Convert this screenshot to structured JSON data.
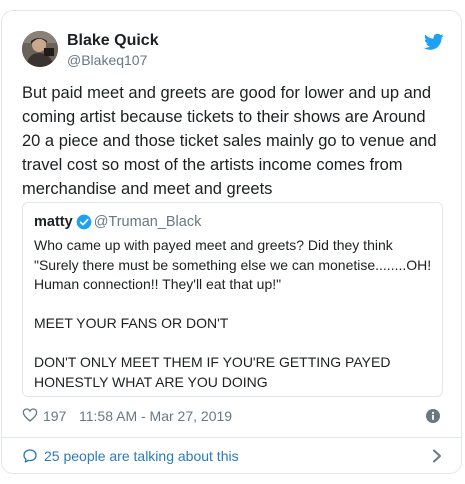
{
  "author": {
    "name": "Blake Quick",
    "handle": "@Blakeq107"
  },
  "tweet": {
    "text": "But paid meet and greets are good for lower and up and coming artist because tickets to their shows are Around 20 a piece and those ticket sales mainly go to venue and travel cost so most of the artists income comes from merchandise and meet and greets"
  },
  "quoted": {
    "name": "matty",
    "handle": "@Truman_Black",
    "text": "Who came up with payed meet and greets? Did they think \"Surely there must be something else we can monetise........OH! Human connection!! They'll eat that up!\"\n\nMEET YOUR FANS OR DON'T\n\nDON'T ONLY MEET THEM IF YOU'RE GETTING PAYED HONESTLY WHAT ARE YOU DOING"
  },
  "meta": {
    "likes": "197",
    "timestamp": "11:58 AM - Mar 27, 2019"
  },
  "footer": {
    "talking": "25 people are talking about this"
  },
  "icons": {
    "bird": "twitter-bird-icon",
    "verified": "verified-badge-icon",
    "heart": "heart-icon",
    "info": "info-icon",
    "bubble": "speech-bubble-icon",
    "chevron": "chevron-right-icon"
  },
  "colors": {
    "brand": "#1da1f2",
    "link": "#2b7bb9",
    "secondary_text": "#697882",
    "border": "#e1e8ed"
  }
}
